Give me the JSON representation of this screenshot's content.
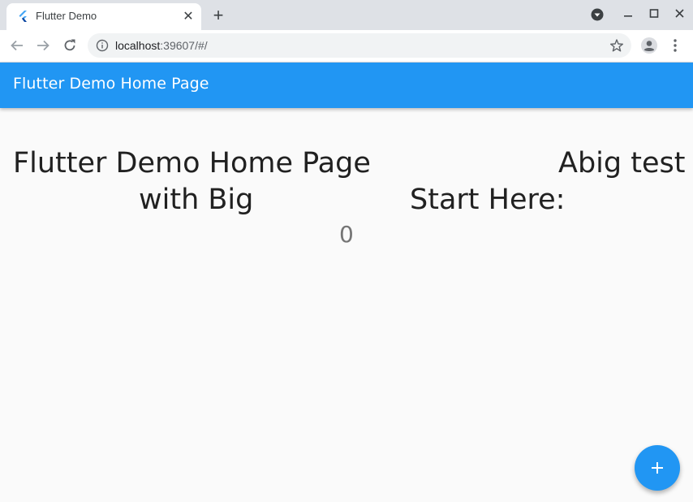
{
  "browser": {
    "tab": {
      "title": "Flutter Demo",
      "close_glyph": "✕"
    },
    "new_tab_glyph": "+",
    "url": {
      "host": "localhost",
      "rest": ":39607/#/"
    }
  },
  "app": {
    "appbar_title": "Flutter Demo Home Page",
    "body": {
      "line1_left": "Flutter Demo Home Page",
      "line1_right": "Abig test",
      "line2_left": "with Big",
      "line2_right": "Start Here:",
      "counter": "0"
    },
    "fab_icon": "add-icon"
  },
  "colors": {
    "primary": "#2196f3",
    "tabstrip": "#dee1e6",
    "background": "#fafafa"
  }
}
